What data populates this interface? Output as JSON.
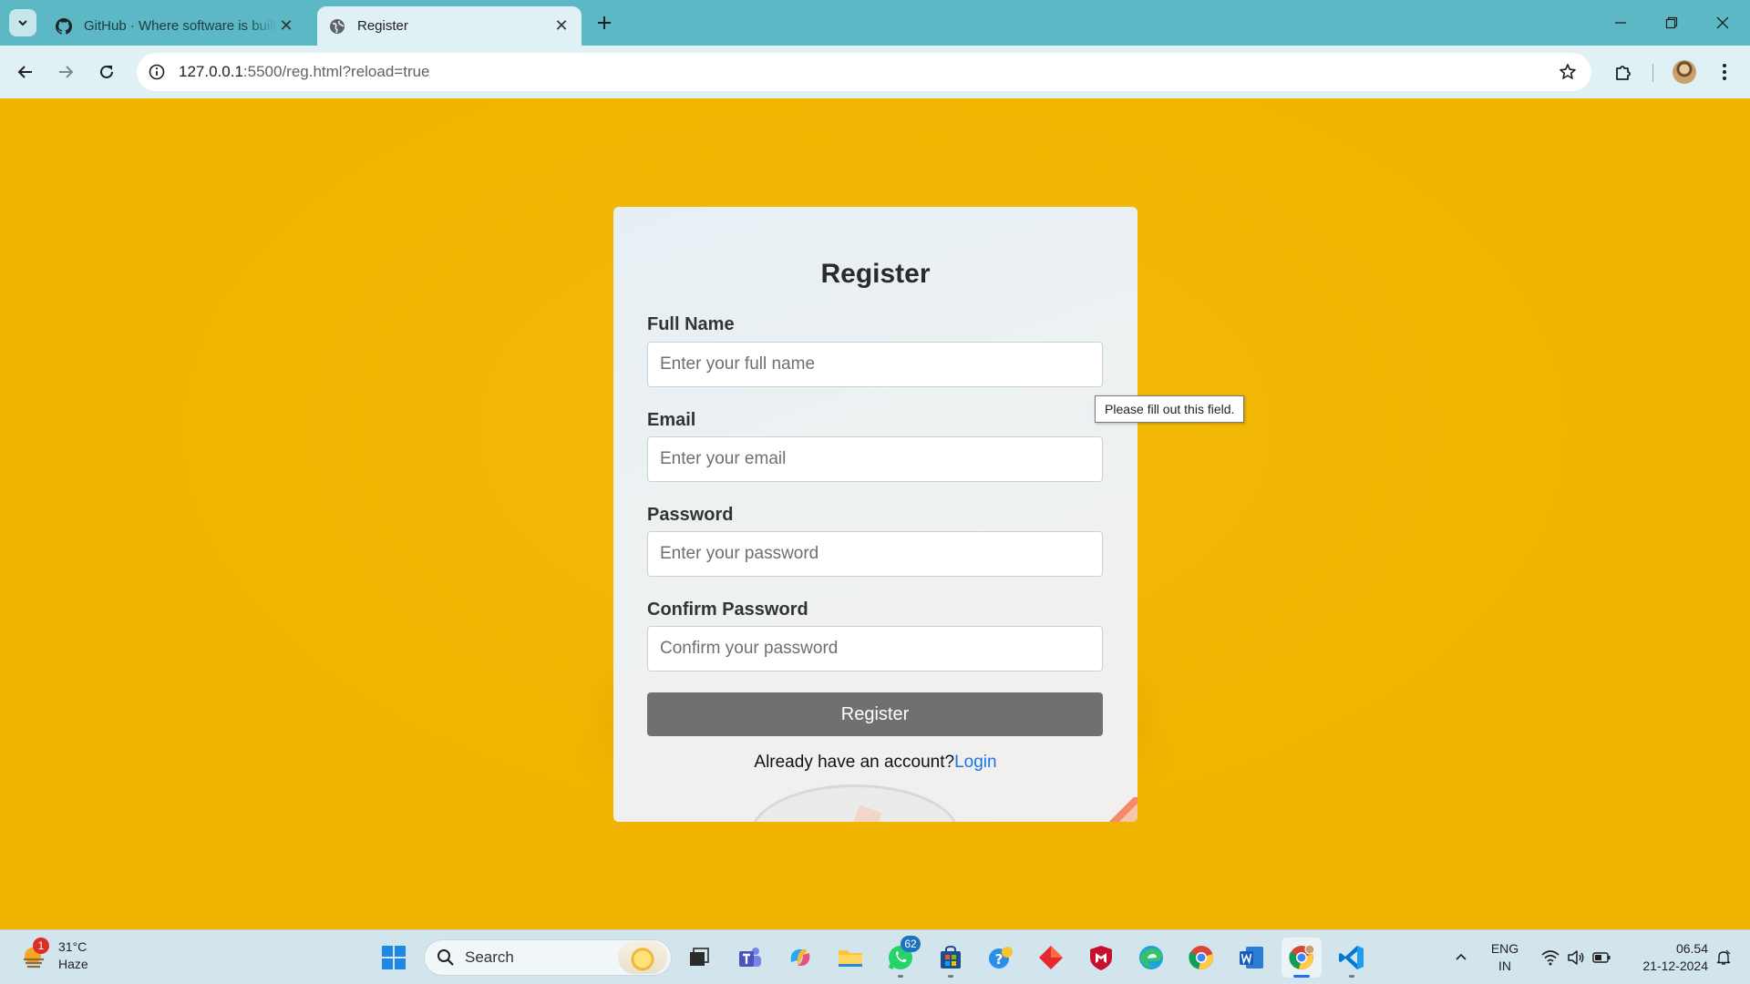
{
  "browser": {
    "tabs": [
      {
        "title": "GitHub · Where software is built",
        "active": false
      },
      {
        "title": "Register",
        "active": true
      }
    ],
    "address": {
      "host": "127.0.0.1",
      "path": ":5500/reg.html?reload=true"
    }
  },
  "form": {
    "title": "Register",
    "fields": [
      {
        "label": "Full Name",
        "placeholder": "Enter your full name"
      },
      {
        "label": "Email",
        "placeholder": "Enter your email"
      },
      {
        "label": "Password",
        "placeholder": "Enter your password"
      },
      {
        "label": "Confirm Password",
        "placeholder": "Confirm your password"
      }
    ],
    "submit_label": "Register",
    "login_prompt": "Already have an account?",
    "login_link": "Login"
  },
  "validation_tooltip": "Please fill out this field.",
  "taskbar": {
    "weather": {
      "temp": "31°C",
      "condition": "Haze",
      "badge": "1"
    },
    "search_label": "Search",
    "whatsapp_badge": "62",
    "language": {
      "line1": "ENG",
      "line2": "IN"
    },
    "clock": {
      "time": "06.54",
      "date": "21-12-2024"
    }
  },
  "colors": {
    "page_background": "#f0b400",
    "button": "#707070",
    "link": "#1a73e8",
    "tabstrip": "#5bb8c4"
  }
}
